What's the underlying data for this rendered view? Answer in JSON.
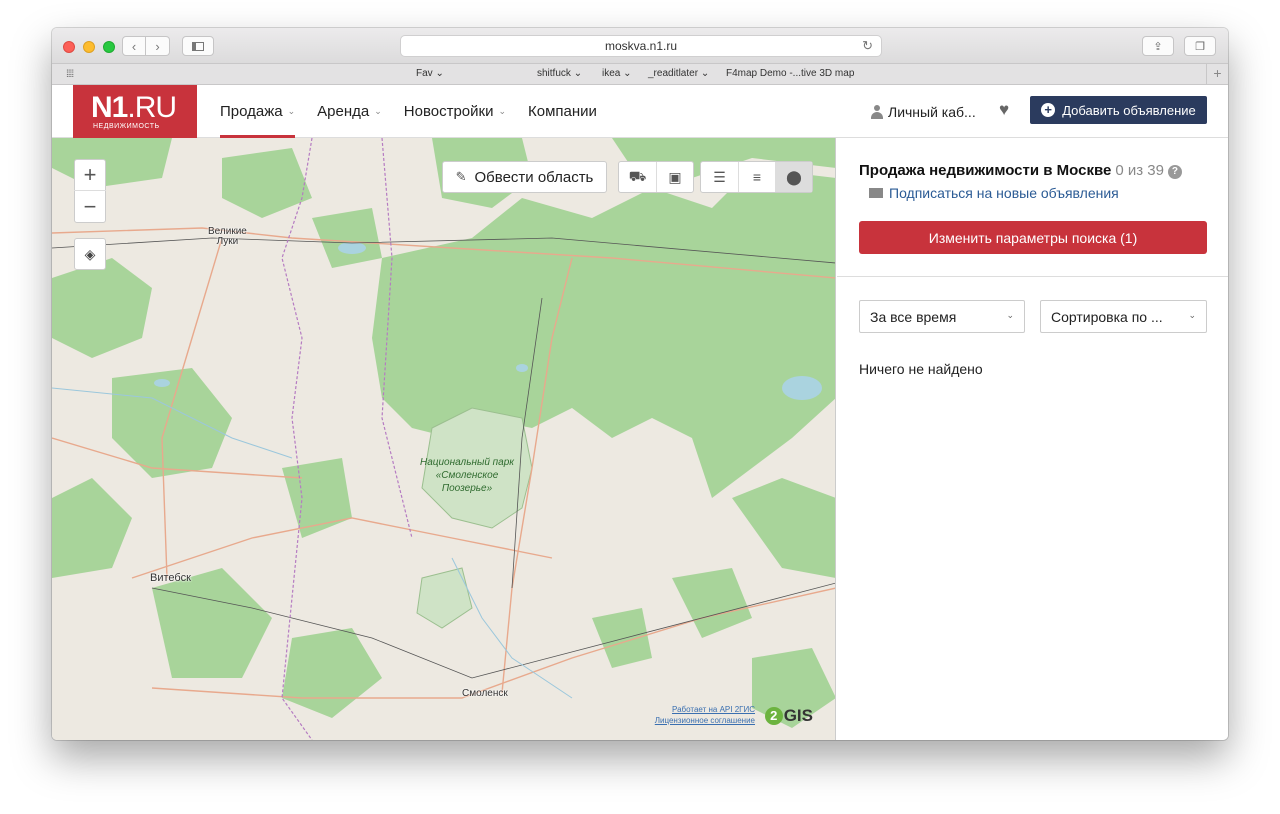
{
  "browser": {
    "url": "moskva.n1.ru",
    "favorites": [
      "Fav",
      "shitfuck",
      "ikea",
      "_readitlater",
      "F4map Demo -...tive 3D map"
    ],
    "favorites_chevron": [
      "⌄",
      "⌄",
      "⌄",
      "⌄",
      ""
    ]
  },
  "header": {
    "logo_main": "N1",
    "logo_suffix": ".RU",
    "logo_sub": "НЕДВИЖИМОСТЬ",
    "menu": [
      {
        "label": "Продажа",
        "active": true
      },
      {
        "label": "Аренда"
      },
      {
        "label": "Новостройки"
      },
      {
        "label": "Компании"
      }
    ],
    "account_label": "Личный каб...",
    "add_button": "Добавить объявление"
  },
  "map": {
    "zoom_in": "+",
    "zoom_out": "−",
    "draw_area_label": "Обвести область",
    "labels": {
      "velikie_luki": "Великие\nЛуки",
      "vitebsk": "Витебск",
      "smolensk": "Смоленск",
      "park": "Национальный парк «Смоленское Поозерье»"
    },
    "credits_line1": "Работает на API 2ГИС",
    "credits_line2": "Лицензионное соглашение",
    "provider_logo": "GIS",
    "provider_logo_num": "2"
  },
  "panel": {
    "title": "Продажа недвижимости в Москве",
    "count": "0 из 39",
    "help": "?",
    "subscribe": "Подписаться на новые объявления",
    "change_search": "Изменить параметры поиска (1)",
    "period_select": "За все время",
    "sort_select": "Сортировка по ...",
    "empty_message": "Ничего не найдено"
  },
  "colors": {
    "brand_red": "#c8333c",
    "navy": "#2b3b5e",
    "link_blue": "#2b5b95",
    "forest": "#a8d49a",
    "map_land": "#ede9e1"
  }
}
